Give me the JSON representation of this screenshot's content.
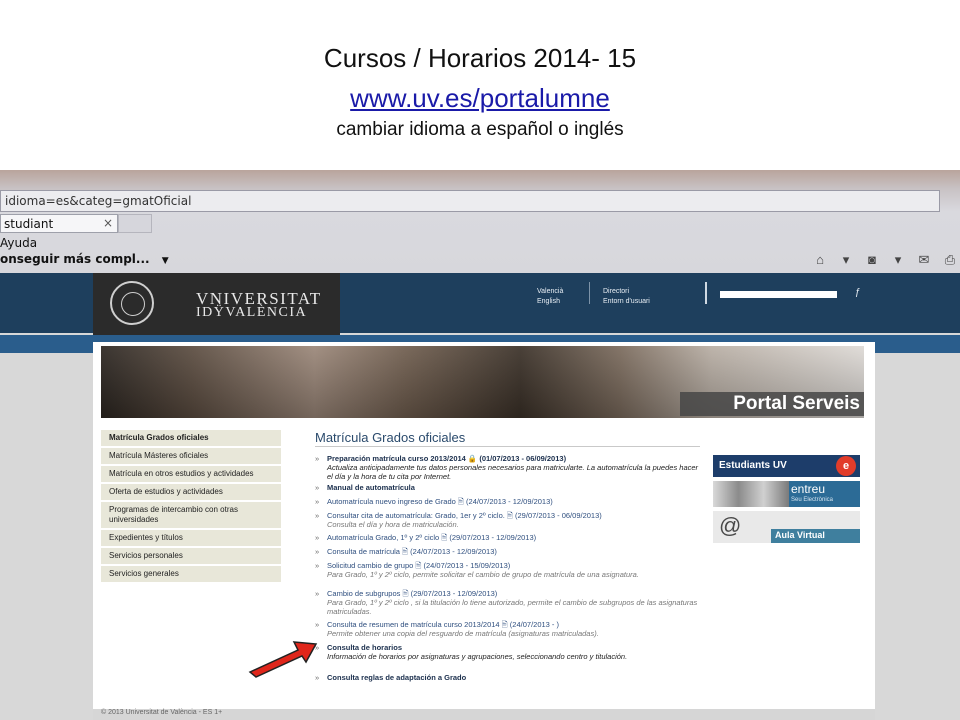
{
  "slide": {
    "title": "Cursos / Horarios 2014- 15",
    "link": "www.uv.es/portalumne",
    "note": "cambiar idioma a español o inglés"
  },
  "browser": {
    "address": "idioma=es&categ=gmatOficial",
    "tab_label": "studiant",
    "tab_close": "×",
    "menu_ayuda": "Ayuda",
    "favorites_label": "onseguir más compl...",
    "icons": [
      "home-icon",
      "rss-icon",
      "print-icon",
      "page-icon"
    ]
  },
  "site": {
    "logo_line1": "VNIVERSITAT",
    "logo_line2": "IDŸVALÈNCIA",
    "lang_1": "Valencià",
    "lang_2": "English",
    "dir_1": "Directori",
    "dir_2": "Entorn d'usuari",
    "search_icon": "search-icon",
    "banner_text": "Portal Serveis"
  },
  "menu": [
    "Matrícula Grados oficiales",
    "Matrícula Másteres oficiales",
    "Matrícula en otros estudios y actividades",
    "Oferta de estudios y actividades",
    "Programas de intercambio con otras universidades",
    "Expedientes y títulos",
    "Servicios personales",
    "Servicios generales"
  ],
  "content": {
    "title": "Matrícula Grados oficiales",
    "items": [
      {
        "label": "Preparación matrícula curso 2013/2014 🔒 (01/07/2013 - 06/09/2013)",
        "desc": "Actualiza anticipadamente tus datos personales necesarios para matricularte. La automatrícula la puedes hacer el día y la hora de tu cita por Internet."
      },
      {
        "label": "Manual de automatrícula",
        "desc": ""
      },
      {
        "label": "Automatrícula nuevo ingreso de Grado 🖹 (24/07/2013 - 12/09/2013)",
        "desc": ""
      },
      {
        "label": "Consultar cita de automatrícula: Grado, 1er y 2º ciclo. 🖹 (29/07/2013 - 06/09/2013)",
        "desc": "Consulta el día y hora de matriculación."
      },
      {
        "label": "Automatrícula Grado, 1º y 2º ciclo 🖹 (29/07/2013 - 12/09/2013)",
        "desc": ""
      },
      {
        "label": "Consulta de matrícula 🖹 (24/07/2013 - 12/09/2013)",
        "desc": ""
      },
      {
        "label": "Solicitud cambio de grupo 🖹 (24/07/2013 - 15/09/2013)",
        "desc": "Para Grado, 1º y 2º ciclo, permite solicitar el cambio de grupo de matrícula de una asignatura."
      },
      {
        "label": "Cambio de subgrupos 🖹 (29/07/2013 - 12/09/2013)",
        "desc": "Para Grado, 1º y 2º ciclo , si la titulación lo tiene autorizado, permite el cambio de subgrupos de las asignaturas matriculadas."
      },
      {
        "label": "Consulta de resumen de matrícula curso 2013/2014 🖹 (24/07/2013 - )",
        "desc": "Permite obtener una copia del resguardo de matrícula (asignaturas matriculadas)."
      },
      {
        "label": "Consulta de horarios",
        "desc": "Información de horarios por asignaturas y agrupaciones, seleccionando centro y titulación."
      },
      {
        "label": "Consulta reglas de adaptación a Grado",
        "desc": ""
      }
    ]
  },
  "banners": {
    "b1": "Estudiants UV",
    "b1_mark": "e",
    "b2_title": "entreu",
    "b2_sub": "Seu Electrònica",
    "b3_mark": "@",
    "b3_label": "Aula Virtual"
  },
  "footer": "© 2013 Universitat de València - ES 1+",
  "colors": {
    "uv_blue": "#1e3f5d",
    "arrow_red": "#e0261b"
  }
}
